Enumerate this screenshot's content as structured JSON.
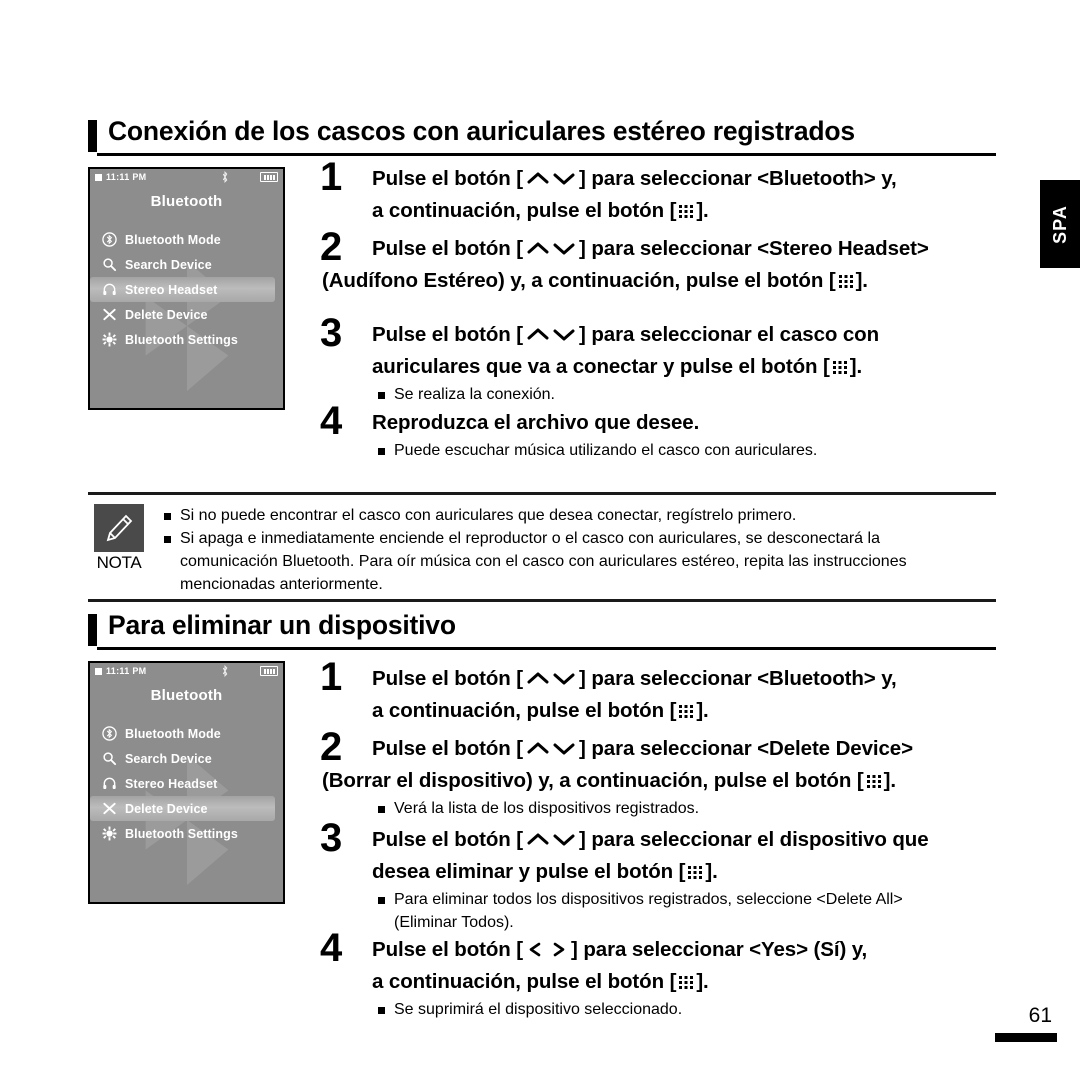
{
  "page": {
    "number": "61",
    "language_tab": "SPA"
  },
  "sections": [
    {
      "heading": "Conexión de los cascos con auriculares estéreo registrados",
      "device": {
        "status": {
          "time": "11:11 PM",
          "bluetooth_icon": "bluetooth-icon",
          "battery_icon": "battery-full-icon"
        },
        "title": "Bluetooth",
        "menu": [
          {
            "icon": "bluetooth-mode-icon",
            "label": "Bluetooth Mode",
            "selected": false
          },
          {
            "icon": "search-icon",
            "label": "Search Device",
            "selected": false
          },
          {
            "icon": "headphones-icon",
            "label": "Stereo Headset",
            "selected": true
          },
          {
            "icon": "close-x-icon",
            "label": "Delete Device",
            "selected": false
          },
          {
            "icon": "gear-icon",
            "label": "Bluetooth Settings",
            "selected": false
          }
        ]
      },
      "steps": [
        {
          "num": "1",
          "lines": [
            {
              "before": "Pulse el botón [",
              "key": "up-down",
              "after": "] para seleccionar <Bluetooth> y,"
            },
            {
              "before": "a continuación, pulse el botón [",
              "key": "dots",
              "after": "]."
            }
          ],
          "bullets": []
        },
        {
          "num": "2",
          "lines": [
            {
              "before": "Pulse el botón [",
              "key": "up-down",
              "after": "] para seleccionar <Stereo Headset>"
            },
            {
              "before": "(Audífono Estéreo) y, a continuación, pulse el botón [",
              "key": "dots",
              "after": "]."
            }
          ],
          "bullets": []
        },
        {
          "num": "3",
          "lines": [
            {
              "before": "Pulse el botón [",
              "key": "up-down",
              "after": "] para seleccionar el casco con"
            },
            {
              "before": "auriculares que va a conectar y pulse el botón [",
              "key": "dots",
              "after": "]."
            }
          ],
          "bullets": [
            "Se realiza la conexión."
          ]
        },
        {
          "num": "4",
          "lines": [
            {
              "before": "Reproduzca el archivo que desee.",
              "key": "",
              "after": ""
            }
          ],
          "bullets": [
            "Puede escuchar música utilizando el casco con auriculares."
          ]
        }
      ]
    },
    {
      "heading": "Para eliminar un dispositivo",
      "device": {
        "status": {
          "time": "11:11 PM",
          "bluetooth_icon": "bluetooth-icon",
          "battery_icon": "battery-full-icon"
        },
        "title": "Bluetooth",
        "menu": [
          {
            "icon": "bluetooth-mode-icon",
            "label": "Bluetooth Mode",
            "selected": false
          },
          {
            "icon": "search-icon",
            "label": "Search Device",
            "selected": false
          },
          {
            "icon": "headphones-icon",
            "label": "Stereo Headset",
            "selected": false
          },
          {
            "icon": "close-x-icon",
            "label": "Delete Device",
            "selected": true
          },
          {
            "icon": "gear-icon",
            "label": "Bluetooth Settings",
            "selected": false
          }
        ]
      },
      "steps": [
        {
          "num": "1",
          "lines": [
            {
              "before": "Pulse el botón [",
              "key": "up-down",
              "after": "] para seleccionar <Bluetooth> y,"
            },
            {
              "before": "a continuación, pulse el botón [",
              "key": "dots",
              "after": "]."
            }
          ],
          "bullets": []
        },
        {
          "num": "2",
          "lines": [
            {
              "before": "Pulse el botón [",
              "key": "up-down",
              "after": "] para seleccionar <Delete Device>"
            },
            {
              "before": "(Borrar el dispositivo) y, a continuación, pulse el botón [",
              "key": "dots",
              "after": "]."
            }
          ],
          "bullets": [
            "Verá la lista de los dispositivos registrados."
          ]
        },
        {
          "num": "3",
          "lines": [
            {
              "before": "Pulse el botón [",
              "key": "up-down",
              "after": "] para seleccionar el dispositivo que"
            },
            {
              "before": "desea eliminar y pulse el botón [",
              "key": "dots",
              "after": "]."
            }
          ],
          "bullets": [
            "Para eliminar todos los dispositivos registrados, seleccione <Delete All>"
          ],
          "bullet_cont": [
            "(Eliminar Todos)."
          ]
        },
        {
          "num": "4",
          "lines": [
            {
              "before": "Pulse el botón [",
              "key": "left-right",
              "after": "] para seleccionar <Yes> (Sí) y,"
            },
            {
              "before": "a continuación, pulse el botón [",
              "key": "dots",
              "after": "]."
            }
          ],
          "bullets": [
            "Se suprimirá el dispositivo seleccionado."
          ]
        }
      ]
    }
  ],
  "note": {
    "icon": "pencil-icon",
    "label": "NOTA",
    "lines": [
      {
        "bullet": true,
        "text": "Si no puede encontrar el casco con auriculares que desea conectar, regístrelo primero."
      },
      {
        "bullet": true,
        "text": "Si apaga e inmediatamente enciende el reproductor o el casco con auriculares, se desconectará la"
      },
      {
        "bullet": false,
        "text": "comunicación Bluetooth. Para oír música con el casco con auriculares estéreo, repita las instrucciones"
      },
      {
        "bullet": false,
        "text": "mencionadas anteriormente."
      }
    ]
  },
  "colors": {
    "device_bg": "#8d8d8d",
    "device_text": "#ffffff",
    "highlight": "#b4b4b4",
    "nota_icon_bg": "#4a4a4a",
    "ink": "#000000"
  }
}
